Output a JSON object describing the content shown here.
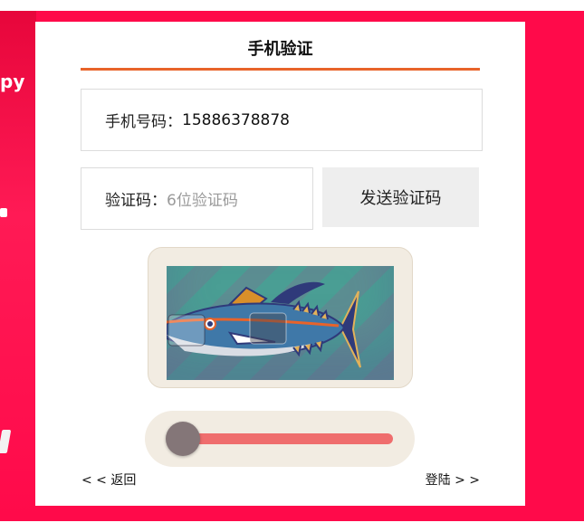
{
  "background": {
    "brand_color": "#ff0a4a",
    "left_edge_text": "py"
  },
  "dialog": {
    "title": "手机验证",
    "accent_color": "#e8632a"
  },
  "phone_field": {
    "label": "手机号码：",
    "value": "15886378878"
  },
  "code_field": {
    "label": "验证码：",
    "placeholder": "6位验证码"
  },
  "send_button": {
    "label": "发送验证码"
  },
  "captcha": {
    "image_subject": "fish-illustration",
    "slider_color": "#ef6d6d",
    "slider_progress": 0
  },
  "footer": {
    "back_label": "< < 返回",
    "login_label": "登陆 > >"
  }
}
